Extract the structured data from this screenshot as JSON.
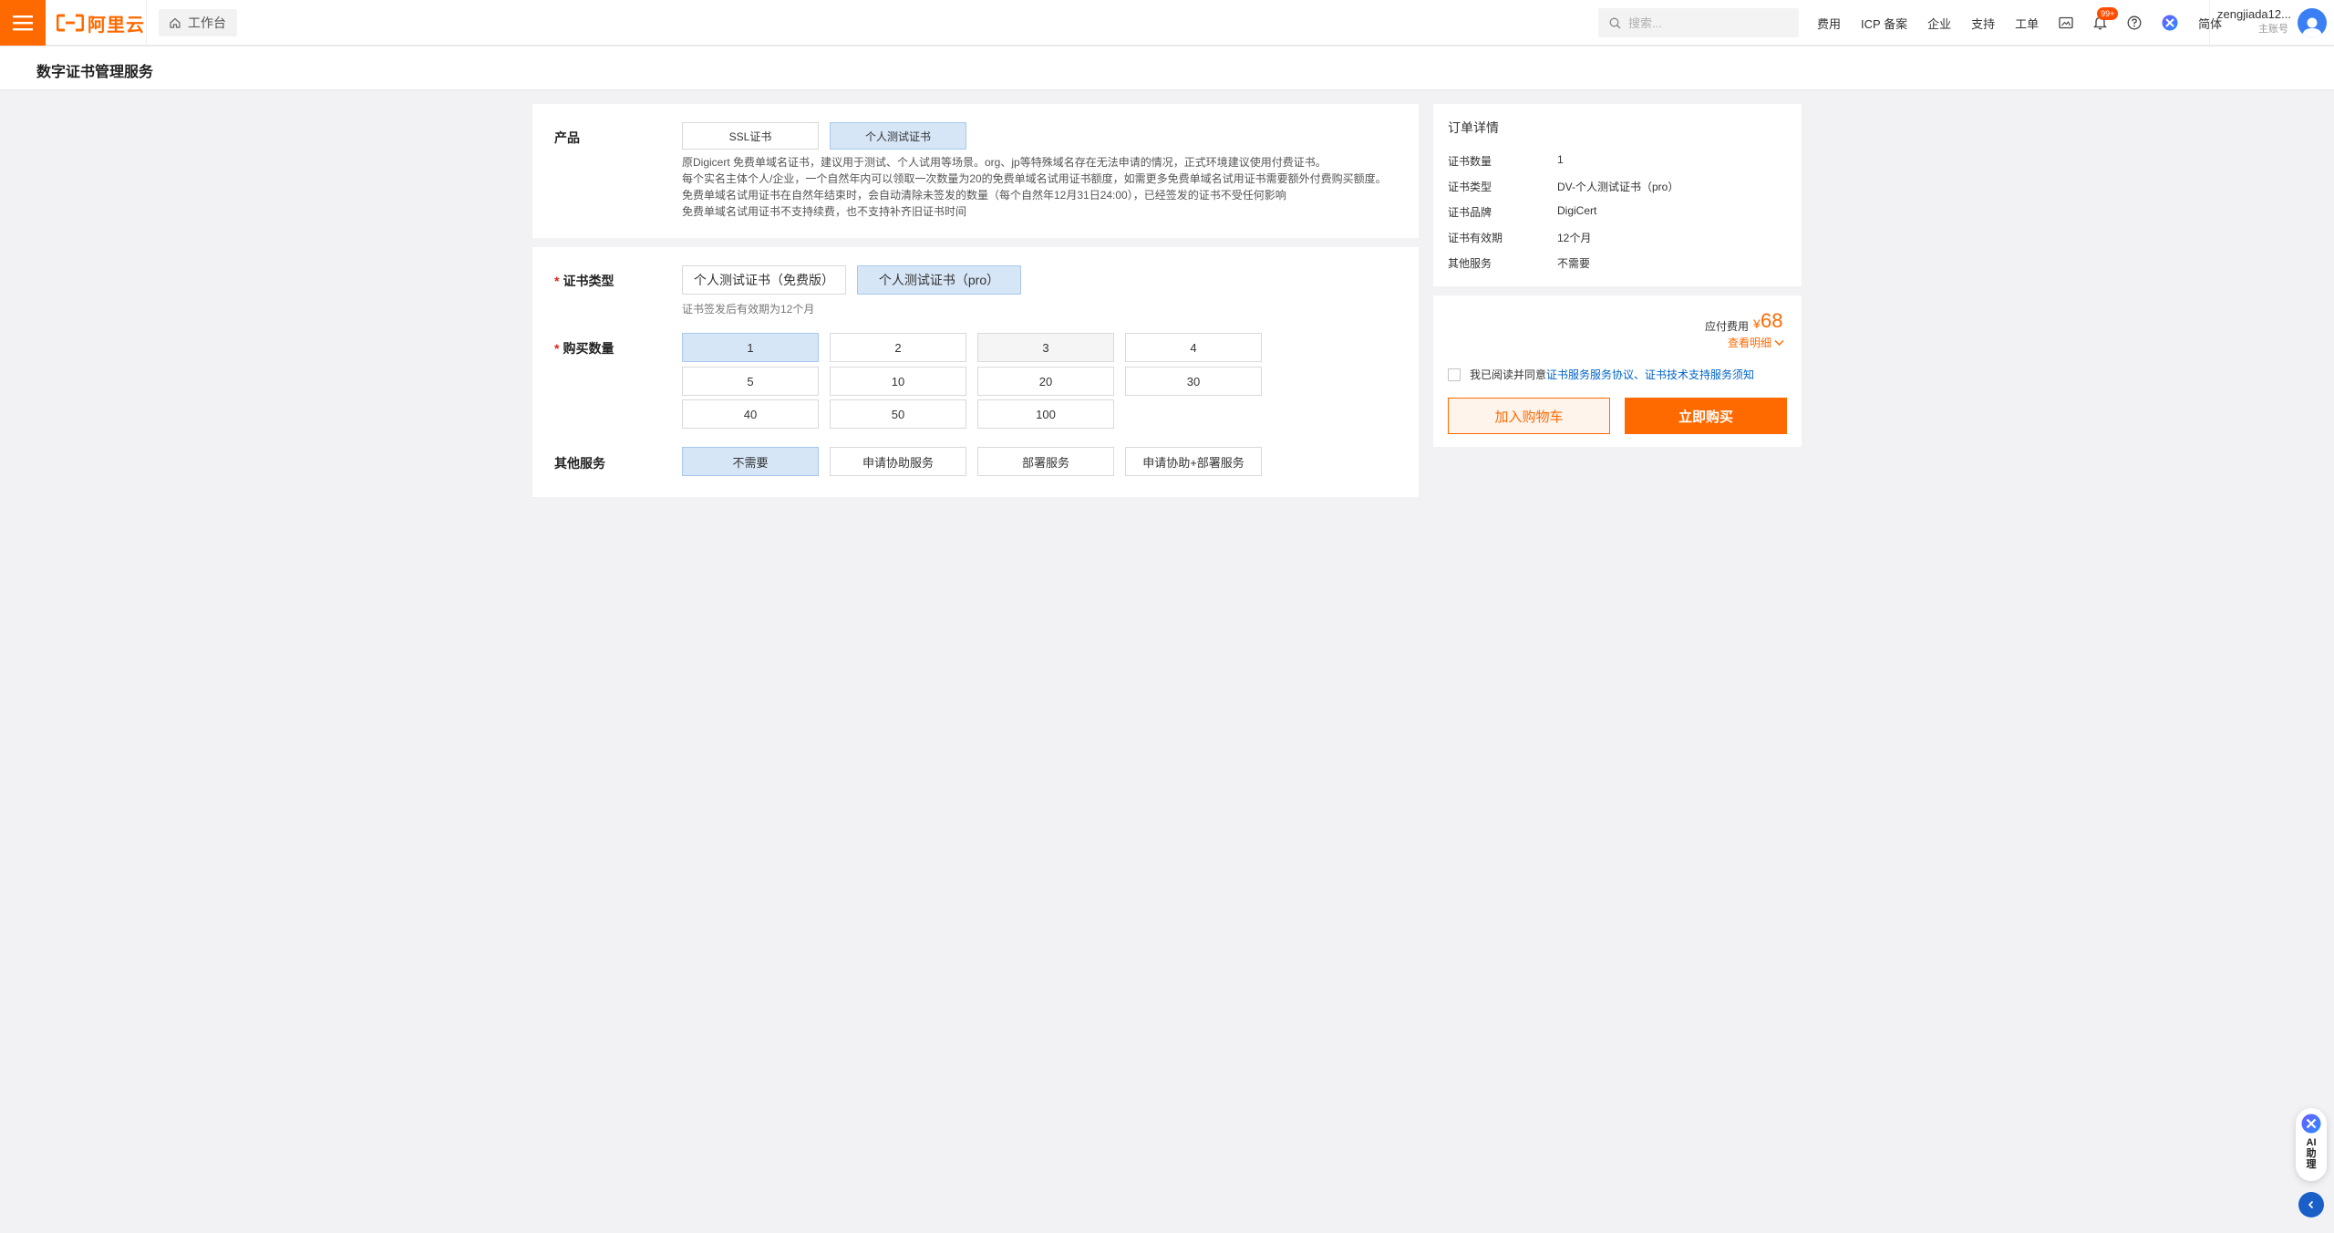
{
  "brand": {
    "logo_text": "阿里云",
    "accent": "#ff6a00"
  },
  "topbar": {
    "workbench_label": "工作台",
    "search_placeholder": "搜索...",
    "links": {
      "fees": "费用",
      "icp": "ICP 备案",
      "enterprise": "企业",
      "support": "支持",
      "ticket": "工单",
      "language": "简体"
    },
    "bell_badge": "99+",
    "user": {
      "name": "zengjiada12...",
      "role": "主账号"
    }
  },
  "page": {
    "title": "数字证书管理服务"
  },
  "product": {
    "label": "产品",
    "options": [
      "SSL证书",
      "个人测试证书"
    ],
    "selected": "个人测试证书",
    "description": [
      "原Digicert 免费单域名证书，建议用于测试、个人试用等场景。org、jp等特殊域名存在无法申请的情况，正式环境建议使用付费证书。",
      "每个实名主体个人/企业，一个自然年内可以领取一次数量为20的免费单域名试用证书额度，如需更多免费单域名试用证书需要额外付费购买额度。",
      "免费单域名试用证书在自然年结束时，会自动清除未签发的数量（每个自然年12月31日24:00），已经签发的证书不受任何影响",
      "免费单域名试用证书不支持续费，也不支持补齐旧证书时间"
    ]
  },
  "cert_type": {
    "label": "证书类型",
    "options": [
      "个人测试证书（免费版）",
      "个人测试证书（pro）"
    ],
    "selected": "个人测试证书（pro）",
    "hint": "证书签发后有效期为12个月"
  },
  "quantity": {
    "label": "购买数量",
    "options": [
      "1",
      "2",
      "3",
      "4",
      "5",
      "10",
      "20",
      "30",
      "40",
      "50",
      "100"
    ],
    "selected": "1"
  },
  "other_service": {
    "label": "其他服务",
    "options": [
      "不需要",
      "申请协助服务",
      "部署服务",
      "申请协助+部署服务"
    ],
    "selected": "不需要"
  },
  "order": {
    "title": "订单详情",
    "rows": [
      {
        "key": "证书数量",
        "value": "1"
      },
      {
        "key": "证书类型",
        "value": "DV-个人测试证书（pro）"
      },
      {
        "key": "证书品牌",
        "value": "DigiCert"
      },
      {
        "key": "证书有效期",
        "value": "12个月"
      },
      {
        "key": "其他服务",
        "value": "不需要"
      }
    ]
  },
  "payment": {
    "label": "应付费用",
    "currency": "¥",
    "amount": "68",
    "detail_link": "查看明细",
    "agree_prefix": "我已阅读并同意",
    "agree_link1": "证书服务服务协议",
    "agree_sep": "、",
    "agree_link2": "证书技术支持服务须知",
    "add_cart": "加入购物车",
    "buy_now": "立即购买"
  },
  "ai_assistant": {
    "label": "AI助理"
  }
}
